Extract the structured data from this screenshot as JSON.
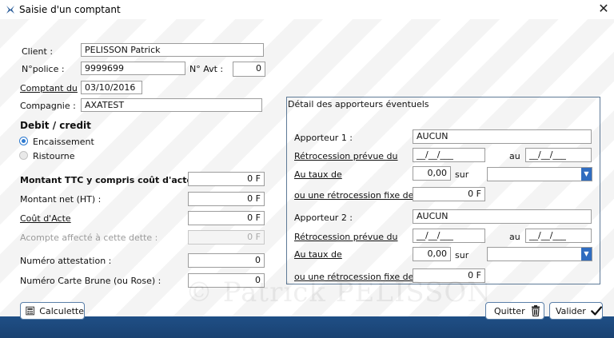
{
  "window": {
    "title": "Saisie d'un comptant",
    "close_symbol": "✕"
  },
  "client": {
    "label": "Client :",
    "value": "PELISSON Patrick",
    "police_label": "N°police :",
    "police_value": "9999699",
    "avt_label": "N° Avt :",
    "avt_value": "0",
    "comptant_label": "Comptant du",
    "comptant_value": "03/10/2016",
    "compagnie_label": "Compagnie :",
    "compagnie_value": "AXATEST"
  },
  "debit_credit": {
    "title": "Debit / credit",
    "option_encaissement": "Encaissement",
    "option_ristourne": "Ristourne",
    "selected": "Encaissement"
  },
  "montants": {
    "ttc_label": "Montant TTC y compris coût d'acte :",
    "ttc_value": "0 F",
    "net_label": "Montant net (HT) :",
    "net_value": "0 F",
    "cout_label": "Coût d'Acte",
    "cout_value": "0 F",
    "acompte_label": "Acompte affecté à cette dette :",
    "acompte_value": "0 F",
    "attestation_label": "Numéro attestation :",
    "attestation_value": "0",
    "carte_label": "Numéro Carte Brune (ou Rose) :",
    "carte_value": "0"
  },
  "apporteurs": {
    "title": "Détail des apporteurs éventuels",
    "a1": {
      "label": "Apporteur 1 :",
      "value": "AUCUN",
      "retro_label": "Rétrocession prévue du",
      "date_from": "__/__/___",
      "au_label": "au",
      "date_to": "__/__/___",
      "taux_label": "Au taux de",
      "taux_value": "0,00",
      "sur_label": "sur",
      "sur_value": "",
      "fixe_label": "ou une rétrocession fixe de (F)",
      "fixe_value": "0 F"
    },
    "a2": {
      "label": "Apporteur 2 :",
      "value": "AUCUN",
      "retro_label": "Rétrocession prévue du",
      "date_from": "__/__/___",
      "au_label": "au",
      "date_to": "__/__/___",
      "taux_label": "Au taux de",
      "taux_value": "0,00",
      "sur_label": "sur",
      "sur_value": "",
      "fixe_label": "ou une rétrocession fixe de (F)",
      "fixe_value": "0 F"
    }
  },
  "watermark": "© Patrick PELISSON",
  "buttons": {
    "calculette": "Calculette",
    "quitter": "Quitter",
    "valider": "Valider"
  },
  "colors": {
    "accent": "#2f7bd0",
    "footer": "#1f4f86",
    "group_border": "#5e7a97"
  }
}
